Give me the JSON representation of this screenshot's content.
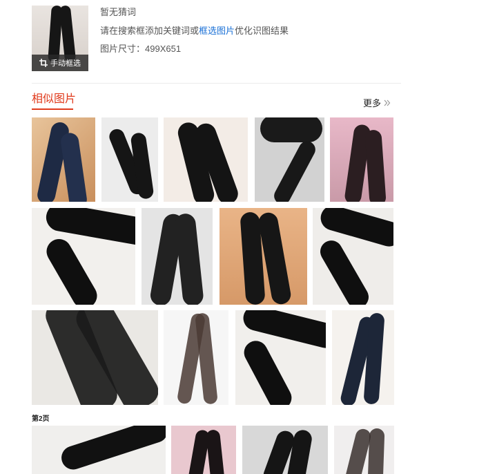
{
  "query": {
    "crop_button_label": "手动框选",
    "crop_icon": "crop-icon",
    "guess_text": "暂无猜词",
    "hint_prefix": "请在搜索框添加关键词或",
    "hint_link": "框选图片",
    "hint_suffix": "优化识图结果",
    "size_text": "图片尺寸：499X651"
  },
  "similar": {
    "title": "相似图片",
    "more_label": "更多",
    "more_icon": "double-chevron-right-icon",
    "accent_color": "#e0391b",
    "link_color": "#1a70d6"
  },
  "pagination": {
    "page2_label": "第2页"
  }
}
